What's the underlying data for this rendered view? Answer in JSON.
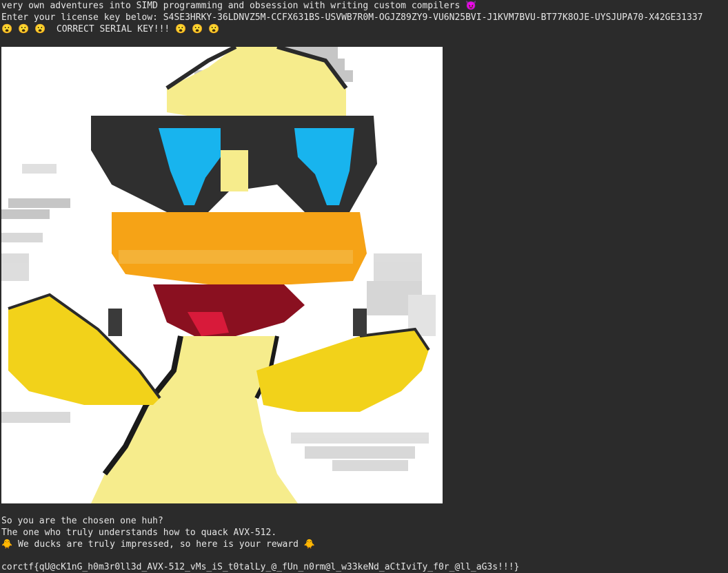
{
  "terminal": {
    "lines": {
      "l1": "very own adventures into SIMD programming and obsession with writing custom compilers 😈",
      "l2": "Enter your license key below: S4SE3HRKY-36LDNVZ5M-CCFX631BS-USVWB7R0M-OGJZ89ZY9-VU6N25BVI-J1KVM7BVU-BT77K8OJE-UYSJUPA70-X42GE31337",
      "l3": "😮 😮 😮  CORRECT SERIAL KEY!!! 😮 😮 😮",
      "l4": "So you are the chosen one huh?",
      "l5": "The one who truly understands how to quack AVX-512.",
      "l6": "🐥 We ducks are truly impressed, so here is your reward 🐥",
      "l7": "corctf{qU@cK1nG_h0m3r0ll3d_AVX-512_vMs_iS_t0talLy_@_fUn_n0rm@l_w33keNd_aCtIviTy_f0r_@ll_aG3s!!!}"
    },
    "colors": {
      "background": "#2b2b2b",
      "text": "#e6e6e6"
    }
  },
  "art": {
    "subject": "duck-ascii-art",
    "colors": {
      "pale_yellow": "#f6ec8c",
      "yellow": "#f2d21a",
      "orange": "#f6a316",
      "blue": "#18b4ee",
      "dark_red": "#8a1020",
      "red": "#d81a3a",
      "dark_gray": "#3a3a3a",
      "black": "#111111"
    }
  }
}
